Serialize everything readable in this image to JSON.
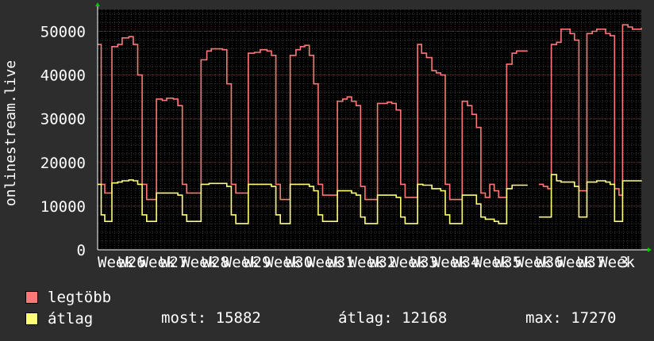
{
  "chart_data": {
    "type": "line",
    "ylabel": "onlinestream.live",
    "ylim": [
      0,
      55000
    ],
    "yticks": [
      0,
      10000,
      20000,
      30000,
      40000,
      50000
    ],
    "ytick_labels": [
      "0",
      "10000",
      "20000",
      "30000",
      "40000",
      "50000"
    ],
    "xlim": [
      0,
      100
    ],
    "xtick_labels": [
      "Week",
      "W26",
      "Week",
      "W27",
      "Week",
      "W28",
      "Week",
      "W29",
      "Week",
      "W30",
      "Week",
      "W31",
      "Week",
      "W32",
      "Week",
      "W33",
      "Week",
      "W34",
      "Week",
      "W35",
      "Week",
      "W36",
      "Week",
      "W37",
      "Week",
      "3"
    ],
    "grid": true,
    "series": [
      {
        "name": "legtöbb",
        "color": "#ff7777",
        "points": [
          [
            0,
            47000
          ],
          [
            0.8,
            15000
          ],
          [
            1.6,
            13000
          ],
          [
            2.5,
            13000
          ],
          [
            3.2,
            46500
          ],
          [
            4.5,
            47000
          ],
          [
            5.5,
            48500
          ],
          [
            7,
            48800
          ],
          [
            8,
            47000
          ],
          [
            9,
            40000
          ],
          [
            10,
            15000
          ],
          [
            11,
            11500
          ],
          [
            12.5,
            11500
          ],
          [
            13.2,
            34500
          ],
          [
            14.5,
            34200
          ],
          [
            15.5,
            34700
          ],
          [
            17,
            34500
          ],
          [
            18,
            33000
          ],
          [
            19,
            15000
          ],
          [
            20,
            13000
          ],
          [
            22.5,
            13000
          ],
          [
            23.2,
            43500
          ],
          [
            24.5,
            45500
          ],
          [
            25.5,
            46000
          ],
          [
            28,
            45800
          ],
          [
            29,
            38000
          ],
          [
            30,
            15000
          ],
          [
            31,
            13000
          ],
          [
            33,
            13000
          ],
          [
            33.8,
            45000
          ],
          [
            35.2,
            45200
          ],
          [
            36.5,
            45800
          ],
          [
            38,
            45500
          ],
          [
            39,
            44500
          ],
          [
            40,
            15000
          ],
          [
            41,
            11500
          ],
          [
            42.5,
            11500
          ],
          [
            43.2,
            44500
          ],
          [
            44.5,
            45800
          ],
          [
            45.5,
            46500
          ],
          [
            46.5,
            46800
          ],
          [
            47.5,
            44500
          ],
          [
            48.5,
            38000
          ],
          [
            49.5,
            15000
          ],
          [
            50.5,
            12500
          ],
          [
            53,
            12500
          ],
          [
            53.8,
            34000
          ],
          [
            55,
            34500
          ],
          [
            56,
            35000
          ],
          [
            57,
            34000
          ],
          [
            58,
            33000
          ],
          [
            59,
            14500
          ],
          [
            60,
            11500
          ],
          [
            62,
            11500
          ],
          [
            62.8,
            33500
          ],
          [
            64,
            33500
          ],
          [
            65,
            33800
          ],
          [
            66,
            33500
          ],
          [
            67,
            32000
          ],
          [
            68,
            15000
          ],
          [
            69,
            12000
          ],
          [
            71,
            12000
          ],
          [
            71.8,
            47000
          ],
          [
            72.7,
            45000
          ],
          [
            73.8,
            44000
          ],
          [
            75,
            41000
          ],
          [
            76,
            40500
          ],
          [
            77,
            40000
          ],
          [
            78,
            15000
          ],
          [
            79,
            11500
          ],
          [
            81,
            11500
          ],
          [
            81.8,
            34000
          ],
          [
            83,
            33000
          ],
          [
            84,
            31000
          ],
          [
            85,
            28000
          ],
          [
            86,
            13000
          ],
          [
            87,
            12000
          ],
          [
            88,
            15000
          ],
          [
            89,
            13500
          ],
          [
            90,
            12000
          ],
          [
            91,
            12000
          ],
          [
            91.8,
            42500
          ],
          [
            93,
            45000
          ],
          [
            94,
            45500
          ],
          [
            95,
            45500
          ],
          [
            96.5,
            45500
          ]
        ],
        "points2": [
          [
            99,
            15000
          ],
          [
            100,
            14500
          ],
          [
            101,
            14000
          ],
          [
            101.8,
            47000
          ],
          [
            103,
            47500
          ],
          [
            104,
            50500
          ],
          [
            105,
            50500
          ],
          [
            106,
            49500
          ],
          [
            107,
            48000
          ],
          [
            108,
            13500
          ],
          [
            109,
            13500
          ],
          [
            109.8,
            49500
          ],
          [
            111,
            50000
          ],
          [
            112,
            50500
          ],
          [
            114,
            49500
          ],
          [
            115,
            49000
          ],
          [
            116,
            14000
          ],
          [
            117,
            12500
          ],
          [
            117.8,
            51500
          ],
          [
            119,
            51000
          ],
          [
            120,
            50500
          ],
          [
            122,
            50800
          ]
        ]
      },
      {
        "name": "átlag",
        "color": "#ffff77",
        "points": [
          [
            0,
            15000
          ],
          [
            0.8,
            8000
          ],
          [
            1.6,
            6500
          ],
          [
            2.5,
            6500
          ],
          [
            3.2,
            15300
          ],
          [
            4.5,
            15500
          ],
          [
            5.5,
            15800
          ],
          [
            7,
            16000
          ],
          [
            8,
            15800
          ],
          [
            9,
            15000
          ],
          [
            10,
            8000
          ],
          [
            11,
            6500
          ],
          [
            12.5,
            6500
          ],
          [
            13.2,
            13000
          ],
          [
            15,
            13000
          ],
          [
            17,
            13000
          ],
          [
            18,
            12500
          ],
          [
            19,
            8000
          ],
          [
            20,
            6500
          ],
          [
            22.5,
            6500
          ],
          [
            23.2,
            15000
          ],
          [
            25,
            15200
          ],
          [
            28,
            15200
          ],
          [
            29,
            14500
          ],
          [
            30,
            8000
          ],
          [
            31,
            6000
          ],
          [
            33,
            6000
          ],
          [
            33.8,
            15000
          ],
          [
            36,
            15000
          ],
          [
            38,
            15000
          ],
          [
            39,
            14500
          ],
          [
            40,
            8000
          ],
          [
            41,
            6000
          ],
          [
            42.5,
            6000
          ],
          [
            43.2,
            15000
          ],
          [
            46,
            15000
          ],
          [
            47.5,
            14500
          ],
          [
            48.5,
            13500
          ],
          [
            49.5,
            8000
          ],
          [
            50.5,
            6500
          ],
          [
            53,
            6500
          ],
          [
            53.8,
            13500
          ],
          [
            56,
            13500
          ],
          [
            57,
            13000
          ],
          [
            58,
            12500
          ],
          [
            59,
            7500
          ],
          [
            60,
            6000
          ],
          [
            62,
            6000
          ],
          [
            62.8,
            12500
          ],
          [
            66,
            12500
          ],
          [
            67,
            12000
          ],
          [
            68,
            7500
          ],
          [
            69,
            6000
          ],
          [
            71,
            6000
          ],
          [
            71.8,
            15000
          ],
          [
            73,
            14800
          ],
          [
            75,
            14000
          ],
          [
            77,
            13500
          ],
          [
            78,
            8000
          ],
          [
            79,
            6000
          ],
          [
            81,
            6000
          ],
          [
            81.8,
            12500
          ],
          [
            84,
            12500
          ],
          [
            85,
            10500
          ],
          [
            86,
            7500
          ],
          [
            87,
            7000
          ],
          [
            88,
            7000
          ],
          [
            89,
            6500
          ],
          [
            90,
            6000
          ],
          [
            91,
            6000
          ],
          [
            91.8,
            14000
          ],
          [
            93,
            14800
          ],
          [
            96.5,
            14800
          ]
        ],
        "points2": [
          [
            99,
            7500
          ],
          [
            101,
            7500
          ],
          [
            101.8,
            17200
          ],
          [
            103,
            15800
          ],
          [
            104,
            15500
          ],
          [
            106,
            15500
          ],
          [
            107,
            14500
          ],
          [
            108,
            7500
          ],
          [
            109,
            7500
          ],
          [
            109.8,
            15500
          ],
          [
            112,
            15800
          ],
          [
            114,
            15500
          ],
          [
            115,
            15000
          ],
          [
            116,
            6500
          ],
          [
            117,
            6500
          ],
          [
            117.8,
            15800
          ],
          [
            122,
            15882
          ]
        ]
      }
    ]
  },
  "legend": {
    "max_label": "legtöbb",
    "avg_label": "átlag",
    "max_color": "#ff7777",
    "avg_color": "#ffff77"
  },
  "stats": {
    "now": "most: 15882",
    "avg": "átlag: 12168",
    "max": "max: 17270"
  }
}
